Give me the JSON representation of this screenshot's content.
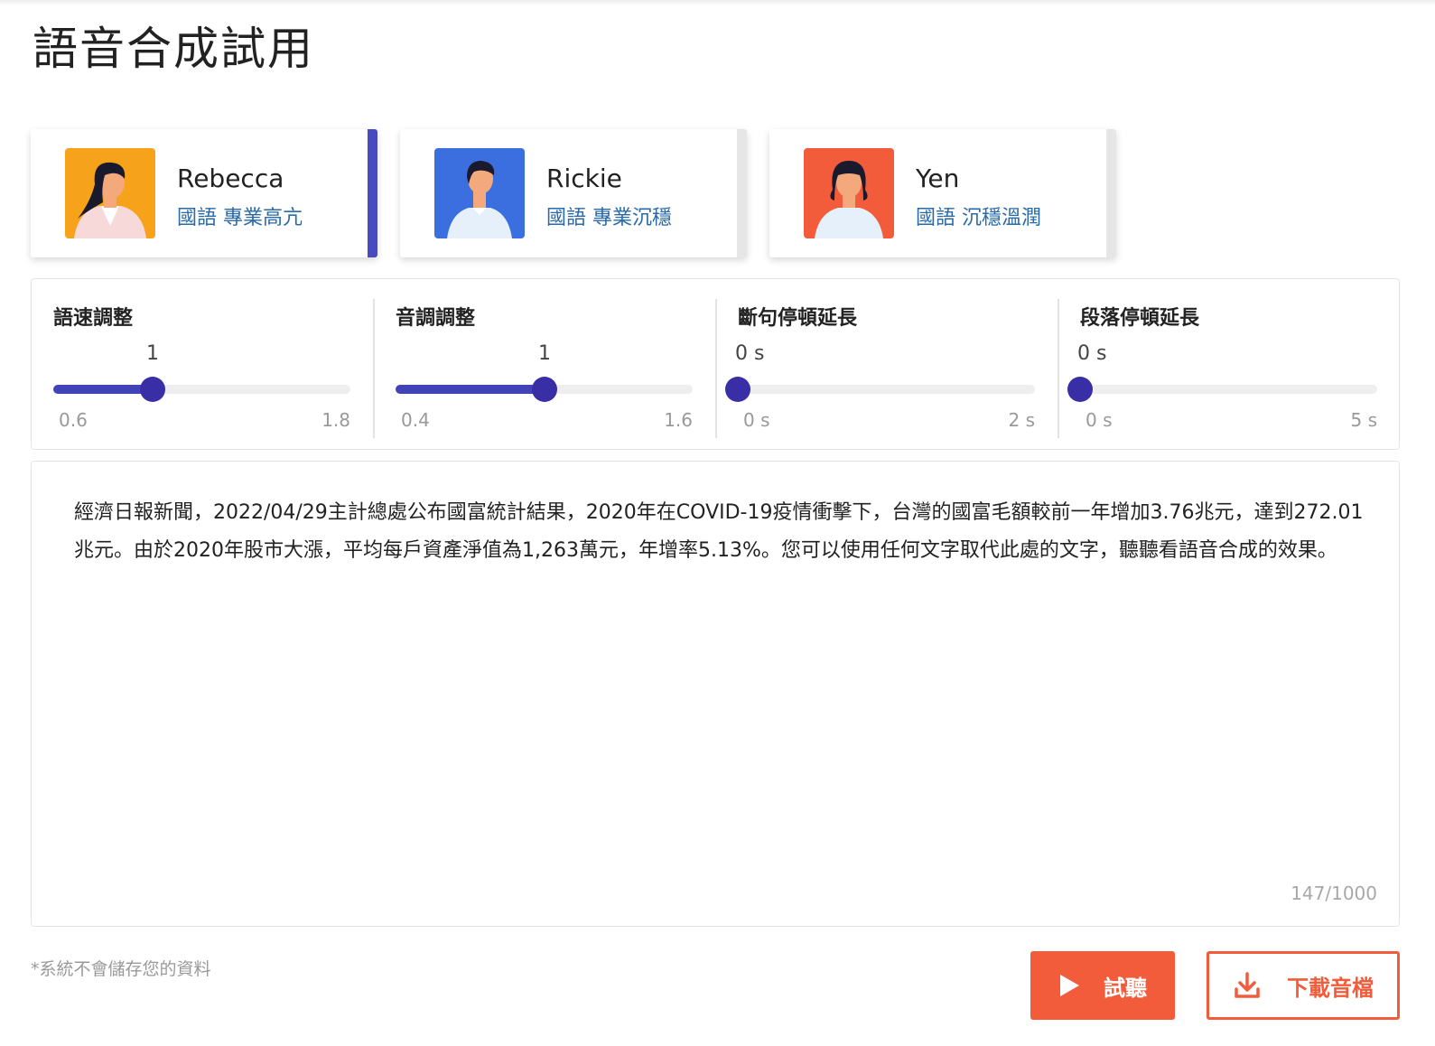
{
  "page": {
    "title": "語音合成試用"
  },
  "voices": [
    {
      "name": "Rebecca",
      "desc": "國語 專業高亢",
      "avatar_bg": "#f7a21b",
      "selected": true
    },
    {
      "name": "Rickie",
      "desc": "國語 專業沉穩",
      "avatar_bg": "#3b6fe0",
      "selected": false
    },
    {
      "name": "Yen",
      "desc": "國語 沉穩溫潤",
      "avatar_bg": "#f25c3b",
      "selected": false
    }
  ],
  "sliders": [
    {
      "label": "語速調整",
      "value": "1",
      "min": "0.6",
      "max": "1.8",
      "fraction": 0.333
    },
    {
      "label": "音調調整",
      "value": "1",
      "min": "0.4",
      "max": "1.6",
      "fraction": 0.5
    },
    {
      "label": "斷句停頓延長",
      "value": "0 s",
      "min": "0  s",
      "max": "2  s",
      "fraction": 0
    },
    {
      "label": "段落停頓延長",
      "value": "0 s",
      "min": "0  s",
      "max": "5  s",
      "fraction": 0
    }
  ],
  "editor": {
    "text": "經濟日報新聞，2022/04/29主計總處公布國富統計結果，2020年在COVID-19疫情衝擊下，台灣的國富毛額較前一年增加3.76兆元，達到272.01兆元。由於2020年股市大漲，平均每戶資產淨值為1,263萬元，年增率5.13%。您可以使用任何文字取代此處的文字，聽聽看語音合成的效果。",
    "char_count": "147/1000"
  },
  "footer": {
    "note": "*系統不會儲存您的資料",
    "listen_label": "試聽",
    "download_label": "下載音檔"
  },
  "colors": {
    "accent": "#f25c3b",
    "slider": "#4343b8",
    "selected_bar": "#4a4ac0",
    "desc_text": "#2a6aa8"
  }
}
